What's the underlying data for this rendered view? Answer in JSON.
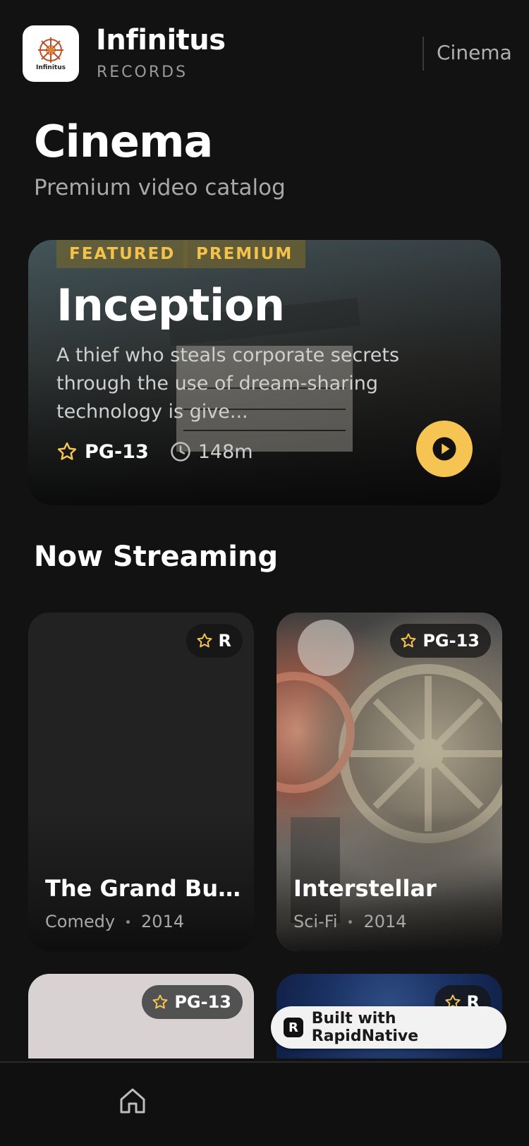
{
  "header": {
    "brand_name": "Infinitus",
    "brand_sub": "RECORDS",
    "logo_text": "Infinitus",
    "nav_link": "Cinema"
  },
  "page": {
    "title": "Cinema",
    "subtitle": "Premium video catalog"
  },
  "featured": {
    "badges": [
      "FEATURED",
      "PREMIUM"
    ],
    "title": "Inception",
    "description": "A thief who steals corporate secrets through the use of dream-sharing technology is give...",
    "rating": "PG-13",
    "duration": "148m",
    "icons": {
      "rating": "star-icon",
      "duration": "clock-icon",
      "play": "play-icon"
    }
  },
  "section": {
    "title": "Now Streaming"
  },
  "movies": [
    {
      "title": "The Grand Bud...",
      "genre": "Comedy",
      "year": "2014",
      "rating": "R"
    },
    {
      "title": "Interstellar",
      "genre": "Sci-Fi",
      "year": "2014",
      "rating": "PG-13"
    },
    {
      "rating": "PG-13"
    },
    {
      "rating": "R"
    }
  ],
  "built_badge": {
    "text": "Built with RapidNative",
    "logo_letter": "R"
  },
  "bottom_nav": {
    "items": [
      {
        "icon": "home-icon"
      }
    ]
  },
  "colors": {
    "background": "#121212",
    "accent": "#f6c453",
    "badge_text": "#f2c24b"
  }
}
